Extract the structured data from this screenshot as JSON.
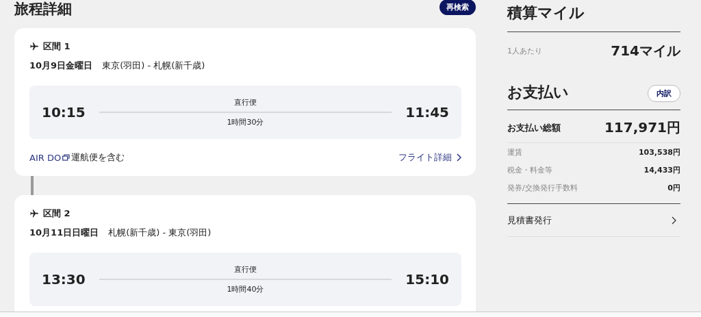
{
  "title": "旅程詳細",
  "research_button": "再検索",
  "segments": [
    {
      "label": "区間 1",
      "date": "10月9日金曜日",
      "route": "東京(羽田) - 札幌(新千歳)",
      "depart": "10:15",
      "arrive": "11:45",
      "type": "直行便",
      "duration": "1時間30分",
      "operator": "AIR DO",
      "operator_note": "運航便を含む",
      "details_link": "フライト詳細"
    },
    {
      "label": "区間 2",
      "date": "10月11日日曜日",
      "route": "札幌(新千歳) - 東京(羽田)",
      "depart": "13:30",
      "arrive": "15:10",
      "type": "直行便",
      "duration": "1時間40分"
    }
  ],
  "miles": {
    "title": "積算マイル",
    "per_person_label": "1人あたり",
    "per_person_value": "714マイル"
  },
  "payment": {
    "title": "お支払い",
    "breakdown_button": "内訳",
    "total_label": "お支払い総額",
    "total_value": "117,971円",
    "items": [
      {
        "label": "運賃",
        "value": "103,538円"
      },
      {
        "label": "税金・料金等",
        "value": "14,433円"
      },
      {
        "label": "発券/交換発行手数料",
        "value": "0円"
      }
    ],
    "quote_link": "見積書発行"
  }
}
